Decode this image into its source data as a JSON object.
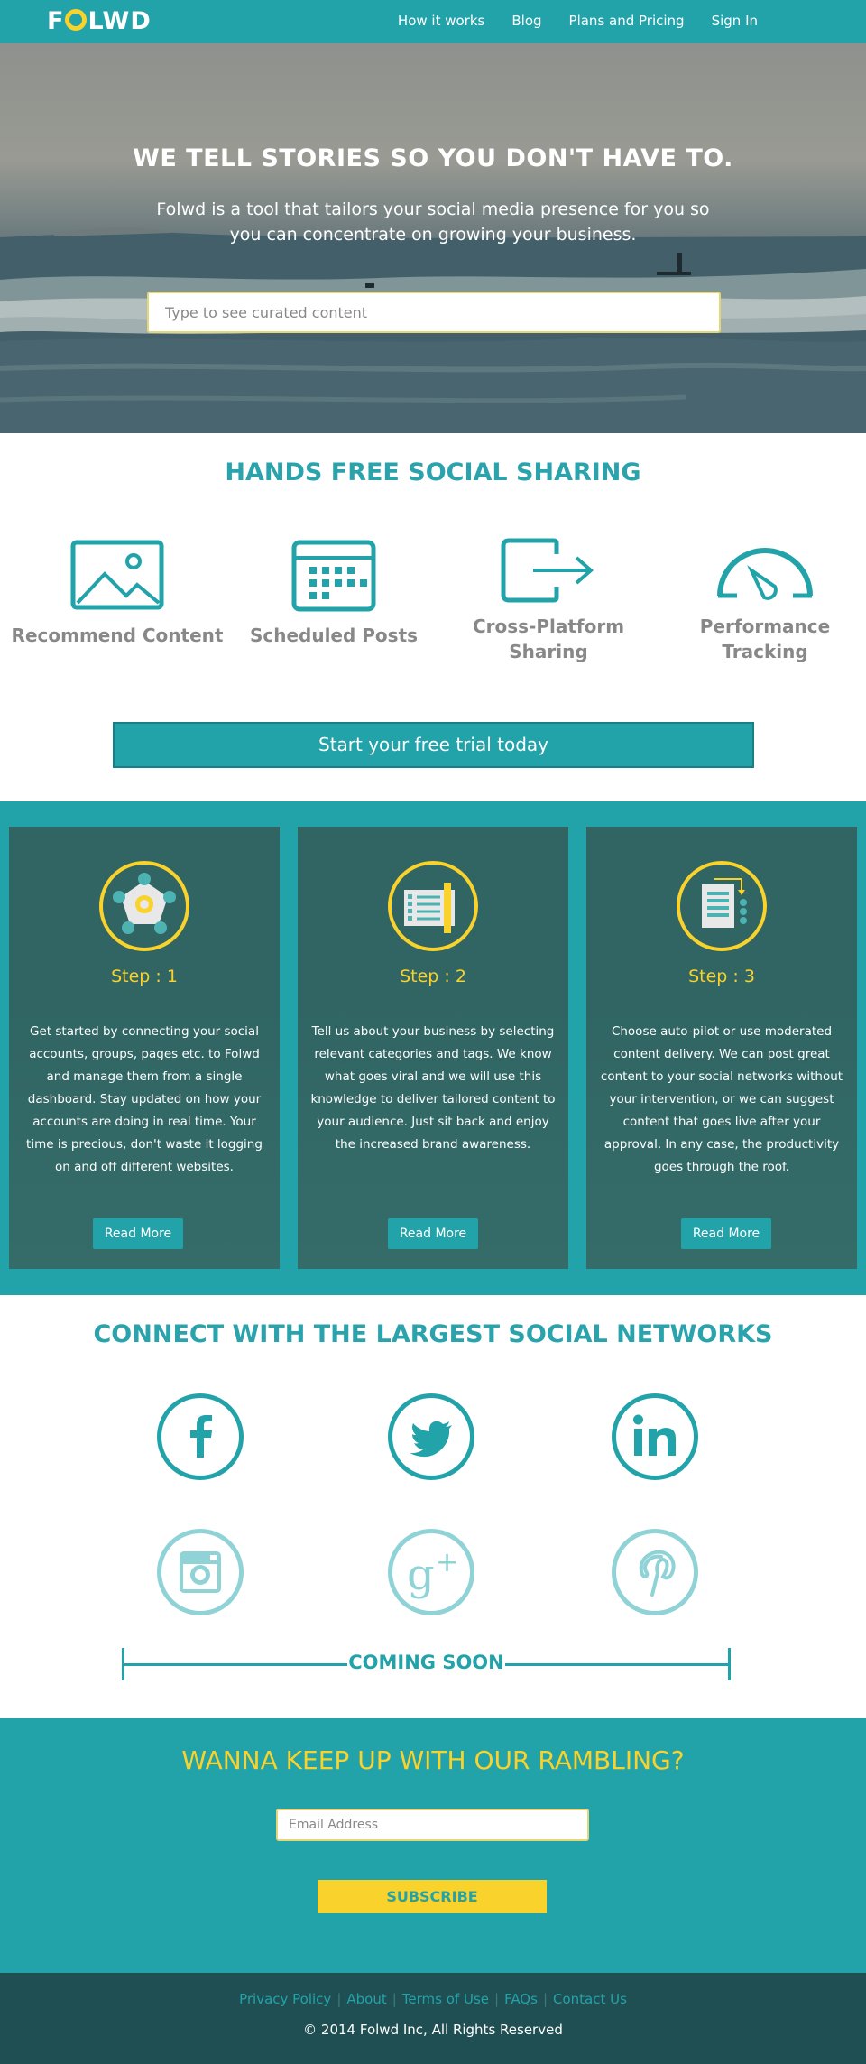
{
  "nav": {
    "logo": "FOLWD",
    "links": [
      "How it works",
      "Blog",
      "Plans and Pricing",
      "Sign In"
    ]
  },
  "hero": {
    "title": "WE TELL STORIES SO YOU DON'T HAVE TO.",
    "subtitle": "Folwd is a tool that tailors your social media presence for you so you can concentrate on growing your business.",
    "search_placeholder": "Type to see curated content"
  },
  "features": {
    "title": "HANDS FREE SOCIAL SHARING",
    "items": [
      {
        "label": "Recommend Content",
        "icon": "image-icon"
      },
      {
        "label": "Scheduled Posts",
        "icon": "calendar-icon"
      },
      {
        "label": "Cross-Platform Sharing",
        "icon": "share-arrow-icon"
      },
      {
        "label": "Performance Tracking",
        "icon": "gauge-icon"
      }
    ],
    "cta_label": "Start your free trial today"
  },
  "steps": [
    {
      "label": "Step : 1",
      "text": "Get started by connecting your social accounts, groups, pages etc. to Folwd and manage them from a single dashboard. Stay updated on how your accounts are doing in real time. Your time is precious, don't waste it logging on and off different websites.",
      "button": "Read More"
    },
    {
      "label": "Step : 2",
      "text": "Tell us about your business by selecting relevant categories and tags. We know what goes viral and we will use this knowledge to deliver tailored content to your audience. Just sit back and enjoy the increased brand awareness.",
      "button": "Read More"
    },
    {
      "label": "Step : 3",
      "text": "Choose auto-pilot or use moderated content delivery. We can post great content to your social networks without your intervention, or we can suggest content that goes live after your approval. In any case, the productivity goes through the roof.",
      "button": "Read More"
    }
  ],
  "social": {
    "title": "CONNECT WITH THE LARGEST SOCIAL NETWORKS",
    "available": [
      "facebook-icon",
      "twitter-icon",
      "linkedin-icon"
    ],
    "upcoming": [
      "instagram-icon",
      "google-plus-icon",
      "pinterest-icon"
    ],
    "coming_soon": "COMING SOON"
  },
  "newsletter": {
    "title": "WANNA KEEP UP WITH OUR RAMBLING?",
    "email_placeholder": "Email Address",
    "button": "SUBSCRIBE"
  },
  "footer": {
    "links": [
      "Privacy Policy",
      "About",
      "Terms of Use",
      "FAQs",
      "Contact Us"
    ],
    "copyright": "© 2014 Folwd Inc, All Rights Reserved"
  },
  "colors": {
    "teal": "#22a3aa",
    "dark_teal": "#306563",
    "yellow": "#f9d22c",
    "footer": "#1f4f52"
  }
}
